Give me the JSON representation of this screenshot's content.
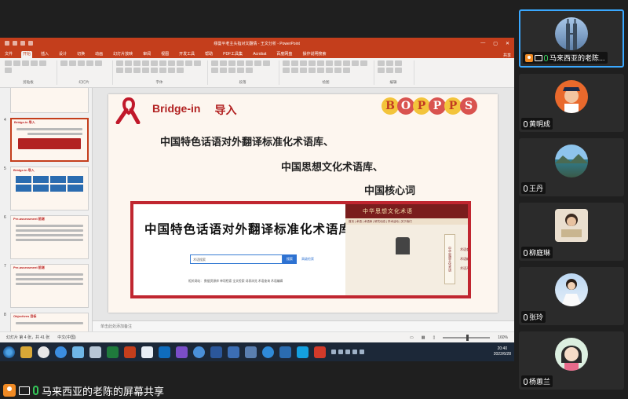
{
  "colors": {
    "ppt_red": "#c43e1c",
    "slide_red": "#b22222",
    "active_speaker": "#3aa8ff",
    "mic_on": "#35c759",
    "share_orange": "#f08a24"
  },
  "ppt": {
    "title": "缪曼平老主头指对文翻情 - 王文分析 - PowerPoint",
    "tabs": [
      "文件",
      "开始",
      "插入",
      "设计",
      "切换",
      "动画",
      "幻灯片放映",
      "审阅",
      "视图",
      "开发工具",
      "帮助",
      "PDF工具集",
      "Acrobat",
      "百度网盘",
      "操作说明搜索"
    ],
    "active_tab_index": 1,
    "share_label": "共享",
    "ribbon_groups": [
      "剪贴板",
      "幻灯片",
      "字体",
      "段落",
      "绘图",
      "编辑"
    ],
    "thumbnails": [
      {
        "num": "4",
        "heading": "Bridge-in 导入",
        "selected": true
      },
      {
        "num": "5",
        "heading": "Bridge-in 导入",
        "selected": false
      },
      {
        "num": "6",
        "heading": "Pre-assessment 前测",
        "selected": false
      },
      {
        "num": "7",
        "heading": "Pre-assessment 前测",
        "selected": false
      },
      {
        "num": "8",
        "heading": "Objectives 目标",
        "selected": false
      }
    ],
    "notes_placeholder": "单击此处添加备注",
    "status_left": "幻灯片 第 4 张，共 41 张",
    "status_lang": "中文(中国)",
    "zoom": "160%"
  },
  "slide": {
    "kicker": "Bridge-in",
    "kicker_cn": "导入",
    "bopps_letters": [
      "B",
      "O",
      "P",
      "P",
      "P",
      "S"
    ],
    "line1": "中国特色话语对外翻译标准化术语库、",
    "line2": "中国思想文化术语库、",
    "line3": "中国核心词",
    "embed": {
      "title": "中国特色话语对外翻译标准化术语库",
      "search_placeholder": "术语搜索",
      "search_button": "搜索",
      "advanced": "高级检索",
      "links": "相关网站：   数据资源库   单项检索   全文检索   词表浏览   术语查询   术语编辑",
      "right_header": "中华思想文化术语",
      "right_nav": "首页 | 术语  | 术语库  | 研究动态  | 学术活动  | 关于我们",
      "scroll_text": "中华思想文化术语",
      "side_items": [
        "术语查询",
        "术语编辑",
        "术语开发"
      ]
    }
  },
  "taskbar": {
    "time": "20:40",
    "date": "2022/6/28"
  },
  "participants": [
    {
      "name": "马来西亚的老陈...",
      "active": true,
      "sharing": true,
      "mic_on": true
    },
    {
      "name": "黄明成",
      "active": false,
      "sharing": false,
      "mic_on": false
    },
    {
      "name": "王丹",
      "active": false,
      "sharing": false,
      "mic_on": false
    },
    {
      "name": "柳庭琳",
      "active": false,
      "sharing": false,
      "mic_on": false
    },
    {
      "name": "张玲",
      "active": false,
      "sharing": false,
      "mic_on": false
    },
    {
      "name": "杨蕙兰",
      "active": false,
      "sharing": false,
      "mic_on": false
    }
  ],
  "banner": {
    "text": "马来西亚的老陈的屏幕共享"
  }
}
